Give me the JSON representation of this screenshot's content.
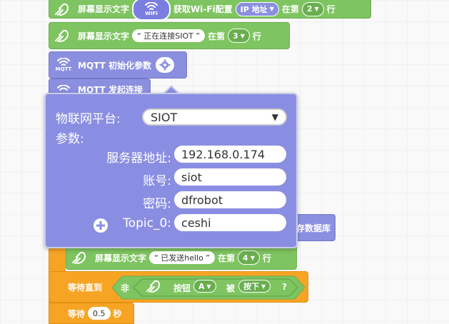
{
  "blocks": {
    "row1": {
      "label": "屏幕显示文字",
      "wifi_text": "WIFI",
      "get_text": "获取Wi-Fi配置",
      "dropdown": "IP 地址",
      "at": "在第",
      "line": "2",
      "suffix": "行"
    },
    "row2": {
      "label": "屏幕显示文字",
      "string": "正在连接SIOT",
      "at": "在第",
      "line": "3",
      "suffix": "行"
    },
    "mqtt_init": {
      "icon_text": "MQTT",
      "label": "MQTT 初始化参数"
    },
    "mqtt_connect": {
      "label": "MQTT 发起连接"
    },
    "save_db": {
      "label": "存数据库"
    },
    "row_sent": {
      "label": "屏幕显示文字",
      "string": "已发送hello",
      "at": "在第",
      "line": "4",
      "suffix": "行"
    },
    "wait_until": {
      "label": "等待直到",
      "not": "非",
      "button": "按钮",
      "button_val": "A",
      "is": "被",
      "state": "按下",
      "q": "?"
    },
    "wait": {
      "label": "等待",
      "value": "0.5",
      "unit": "秒"
    }
  },
  "popup": {
    "platform_label": "物联网平台:",
    "platform_value": "SIOT",
    "params_label": "参数:",
    "server_label": "服务器地址:",
    "server_value": "192.168.0.174",
    "account_label": "账号:",
    "account_value": "siot",
    "password_label": "密码:",
    "password_value": "dfrobot",
    "topic_label": "Topic_0:",
    "topic_value": "ceshi"
  },
  "colors": {
    "green": "#7ec460",
    "purple": "#8b8fe0",
    "orange": "#f7a425"
  }
}
